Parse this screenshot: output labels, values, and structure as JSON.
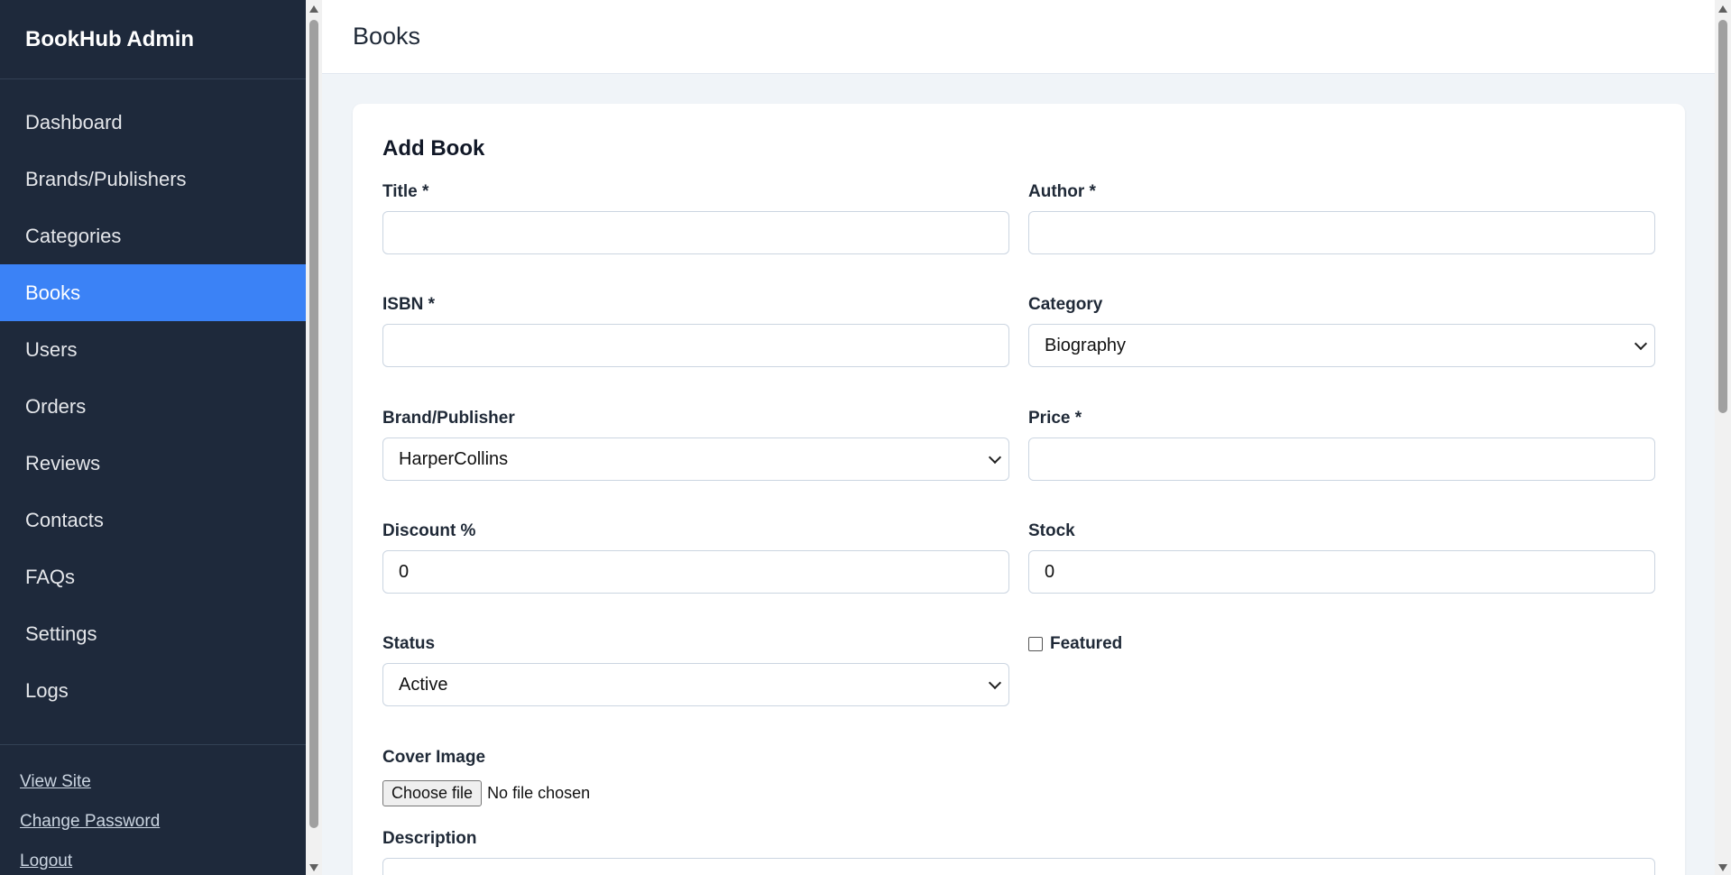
{
  "sidebar": {
    "brand": "BookHub Admin",
    "items": [
      {
        "label": "Dashboard"
      },
      {
        "label": "Brands/Publishers"
      },
      {
        "label": "Categories"
      },
      {
        "label": "Books",
        "active": true
      },
      {
        "label": "Users"
      },
      {
        "label": "Orders"
      },
      {
        "label": "Reviews"
      },
      {
        "label": "Contacts"
      },
      {
        "label": "FAQs"
      },
      {
        "label": "Settings"
      },
      {
        "label": "Logs"
      }
    ],
    "footer_links": [
      {
        "label": "View Site"
      },
      {
        "label": "Change Password"
      },
      {
        "label": "Logout"
      }
    ],
    "colors": {
      "background": "#1e293b",
      "active": "#3b82f6"
    }
  },
  "header": {
    "title": "Books"
  },
  "form": {
    "title": "Add Book",
    "title_field": {
      "label": "Title *",
      "value": ""
    },
    "author_field": {
      "label": "Author *",
      "value": ""
    },
    "isbn_field": {
      "label": "ISBN *",
      "value": ""
    },
    "category_field": {
      "label": "Category",
      "value": "Biography"
    },
    "brand_field": {
      "label": "Brand/Publisher",
      "value": "HarperCollins"
    },
    "price_field": {
      "label": "Price *",
      "value": ""
    },
    "discount_field": {
      "label": "Discount %",
      "value": "0"
    },
    "stock_field": {
      "label": "Stock",
      "value": "0"
    },
    "status_field": {
      "label": "Status",
      "value": "Active"
    },
    "featured": {
      "label": "Featured",
      "checked": false
    },
    "cover_image": {
      "label": "Cover Image",
      "button": "Choose file",
      "status": "No file chosen"
    },
    "description": {
      "label": "Description"
    }
  }
}
